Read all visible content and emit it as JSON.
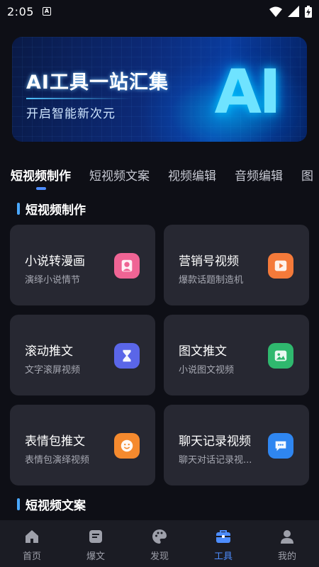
{
  "status_bar": {
    "time": "2:05",
    "notif": "A"
  },
  "banner": {
    "title": "AI工具一站汇集",
    "subtitle": "开启智能新次元",
    "logo": "AI"
  },
  "tabs": [
    "短视频制作",
    "短视频文案",
    "视频编辑",
    "音频编辑",
    "图"
  ],
  "sections": [
    {
      "title": "短视频制作",
      "cards": [
        {
          "title": "小说转漫画",
          "desc": "演绎小说情节",
          "icon": "user-face-icon",
          "color": "#ef6494"
        },
        {
          "title": "营销号视频",
          "desc": "爆款话题制造机",
          "icon": "play-video-icon",
          "color": "#f47a3a"
        },
        {
          "title": "滚动推文",
          "desc": "文字滚屏视频",
          "icon": "hourglass-icon",
          "color": "#5a66e8"
        },
        {
          "title": "图文推文",
          "desc": "小说图文视频",
          "icon": "image-edit-icon",
          "color": "#2fb86e"
        },
        {
          "title": "表情包推文",
          "desc": "表情包演绎视频",
          "icon": "smile-icon",
          "color": "#f58a2e"
        },
        {
          "title": "聊天记录视频",
          "desc": "聊天对话记录视...",
          "icon": "chat-bubble-icon",
          "color": "#2f86f0"
        }
      ]
    },
    {
      "title": "短视频文案"
    }
  ],
  "bottom_nav": [
    {
      "label": "首页",
      "icon": "home-icon"
    },
    {
      "label": "爆文",
      "icon": "document-icon"
    },
    {
      "label": "发现",
      "icon": "palette-icon"
    },
    {
      "label": "工具",
      "icon": "toolbox-icon",
      "active": true
    },
    {
      "label": "我的",
      "icon": "person-icon"
    }
  ],
  "colors": {
    "accent": "#4d8dff",
    "background": "#0e0f16",
    "card": "#272832"
  }
}
